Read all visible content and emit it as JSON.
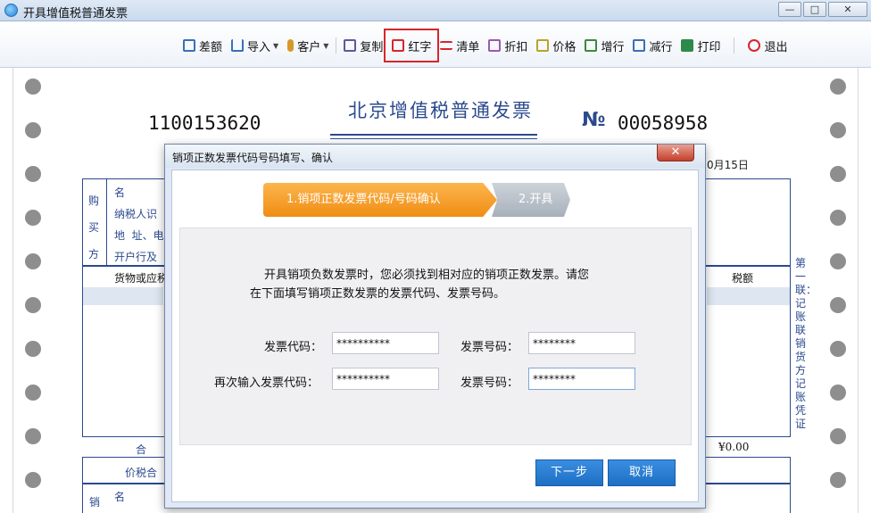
{
  "window": {
    "title": "开具增值税普通发票",
    "minimize": "—",
    "maximize": "□",
    "close": "✕"
  },
  "toolbar": {
    "items": [
      {
        "label": "差额",
        "icon": "diff-icon",
        "color": "#3b6fb6"
      },
      {
        "label": "导入",
        "icon": "import-icon",
        "color": "#3b6fb6"
      },
      {
        "label": "客户",
        "icon": "customer-icon",
        "color": "#d69a2a"
      },
      {
        "label": "复制",
        "icon": "copy-icon",
        "color": "#5a5a9a"
      },
      {
        "label": "红字",
        "icon": "red-invoice-icon",
        "color": "#d6262c"
      },
      {
        "label": "清单",
        "icon": "list-icon",
        "color": "#d6262c"
      },
      {
        "label": "折扣",
        "icon": "discount-icon",
        "color": "#9a5ab0"
      },
      {
        "label": "价格",
        "icon": "price-icon",
        "color": "#b8a52a"
      },
      {
        "label": "增行",
        "icon": "add-row-icon",
        "color": "#3b8a3b"
      },
      {
        "label": "减行",
        "icon": "remove-row-icon",
        "color": "#3b6fb6"
      },
      {
        "label": "打印",
        "icon": "print-icon",
        "color": "#2d8a4a"
      },
      {
        "label": "退出",
        "icon": "exit-icon",
        "color": "#d6262c"
      }
    ]
  },
  "invoice": {
    "title": "北京增值税普通发票",
    "code": "1100153620",
    "number_mark": "№",
    "number": "00058958",
    "date_fragment": "0月15日",
    "buyer_section": "购\n买\n方",
    "buyer_fields": [
      "名",
      "纳税人识",
      "地  址、电",
      "开户行及"
    ],
    "goods_header": "货物或应税",
    "tax_header": "税额",
    "total_label": "合",
    "total_amount": "¥0.00",
    "price_tax_label": "价税合",
    "seller_section": "销",
    "seller_name": "名",
    "side_note": "第一联：记账联 销货方记账凭证"
  },
  "dialog": {
    "title": "销项正数发票代码号码填写、确认",
    "close_label": "✕",
    "step1": "1.销项正数发票代码/号码确认",
    "step2": "2.开具",
    "message_line1": "开具销项负数发票时，您必须找到相对应的销项正数发票。请您",
    "message_line2": "在下面填写销项正数发票的发票代码、发票号码。",
    "fields": {
      "code_label": "发票代码：",
      "code_value": "**********",
      "number_label": "发票号码：",
      "number_value": "********",
      "code_confirm_label": "再次输入发票代码：",
      "code_confirm_value": "**********",
      "number_confirm_label": "发票号码：",
      "number_confirm_value": "********"
    },
    "next_button": "下一步",
    "cancel_button": "取消"
  }
}
